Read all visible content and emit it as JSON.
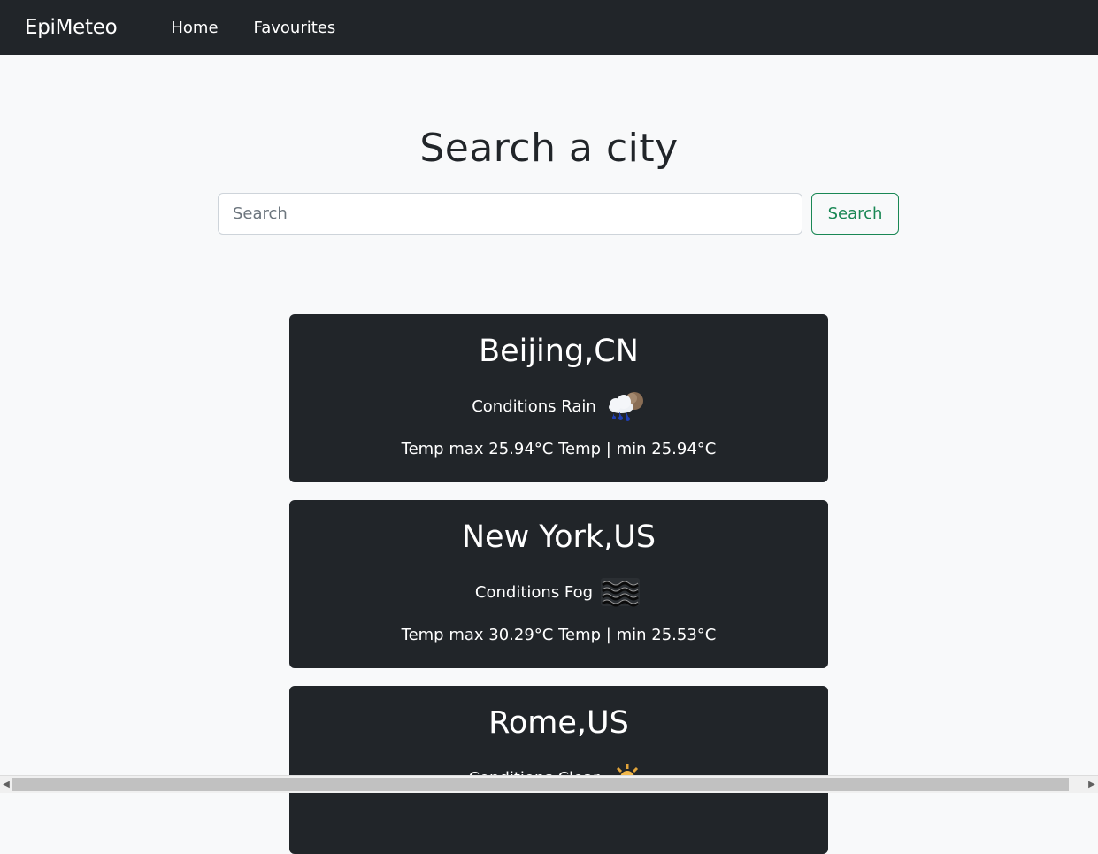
{
  "navbar": {
    "brand": "EpiMeteo",
    "links": [
      "Home",
      "Favourites"
    ]
  },
  "search": {
    "title": "Search a city",
    "placeholder": "Search",
    "button_label": "Search"
  },
  "cards": [
    {
      "city": "Beijing,CN",
      "condition": "Conditions Rain",
      "icon": "rain-cloud-icon",
      "temp": "Temp max 25.94°C Temp | min 25.94°C"
    },
    {
      "city": "New York,US",
      "condition": "Conditions Fog",
      "icon": "fog-icon",
      "temp": "Temp max 30.29°C Temp | min 25.53°C"
    },
    {
      "city": "Rome,US",
      "condition": "Conditions Clear",
      "icon": "sun-icon",
      "temp": ""
    }
  ],
  "colors": {
    "navbar": "#212529",
    "page_bg": "#f8f9fa",
    "accent_green": "#198754",
    "card_bg": "#212529"
  }
}
